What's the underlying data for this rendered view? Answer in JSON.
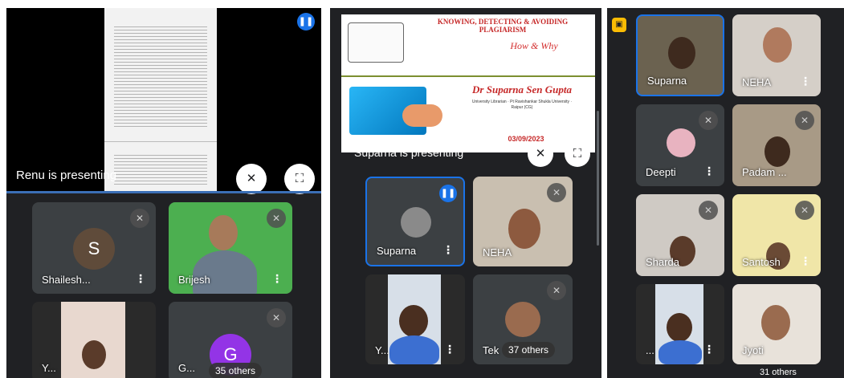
{
  "left_panel": {
    "presenting_label": "Renu is presenting",
    "tiles": [
      {
        "name": "Shailesh...",
        "initial": "S"
      },
      {
        "name": "Brijesh"
      },
      {
        "name": "Y..."
      },
      {
        "name": "G...",
        "initial": "G",
        "others_label": "35 others"
      }
    ]
  },
  "middle_panel": {
    "slide": {
      "title": "KNOWING, DETECTING & AVOIDING PLAGIARISM",
      "subtitle": "How & Why",
      "author": "Dr Suparna Sen Gupta",
      "affiliation": "University Librarian · Pt Ravishankar Shukla University · Raipur (CG)",
      "date": "03/09/2023"
    },
    "presenting_label": "Suparna is presenting",
    "tiles": [
      {
        "name": "Suparna"
      },
      {
        "name": "NEHA"
      },
      {
        "name": "Y..."
      },
      {
        "name": "Tek",
        "others_label": "37 others"
      }
    ]
  },
  "right_panel": {
    "tiles": [
      {
        "name": "Suparna"
      },
      {
        "name": "NEHA"
      },
      {
        "name": "Deepti"
      },
      {
        "name": "Padam ..."
      },
      {
        "name": "Sharda"
      },
      {
        "name": "Santosh"
      },
      {
        "name": "..."
      },
      {
        "name": "Jyoti"
      }
    ],
    "others_label": "31 others"
  },
  "colors": {
    "background": "#202124",
    "tile": "#3c4043",
    "accent": "#1a73e8",
    "avatar_s": "#5f4b3a",
    "avatar_g": "#9334e6",
    "green_screen": "#4caf50"
  },
  "icons": [
    "mic-off-icon",
    "fullscreen-icon",
    "speaking-indicator-icon",
    "more-options-icon",
    "presenting-icon"
  ]
}
